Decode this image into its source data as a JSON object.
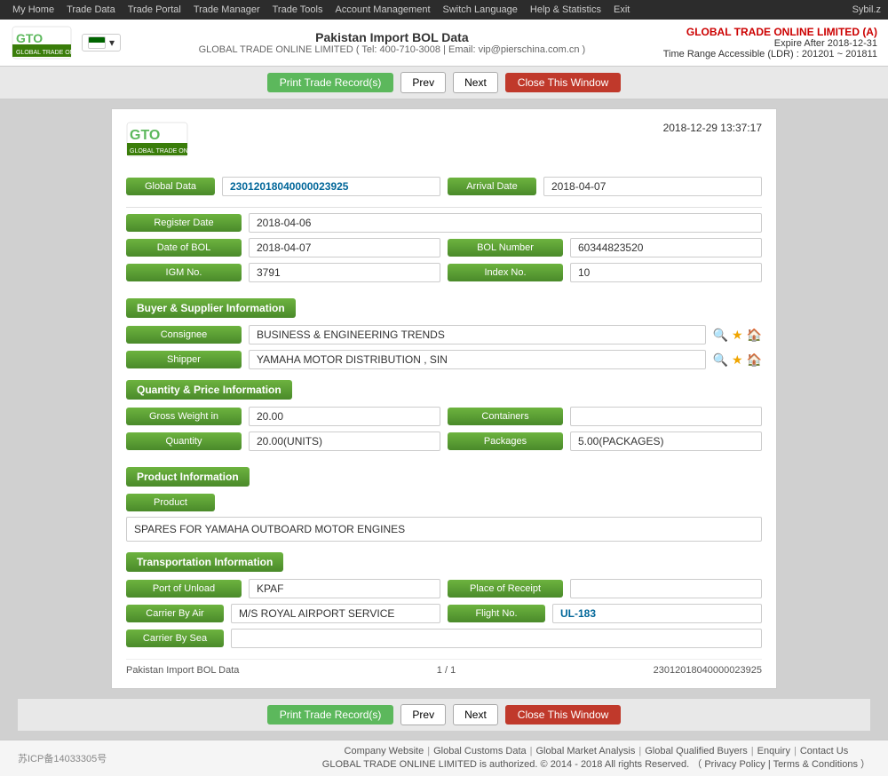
{
  "topNav": {
    "items": [
      "My Home",
      "Trade Data",
      "Trade Portal",
      "Trade Manager",
      "Trade Tools",
      "Account Management",
      "Switch Language",
      "Help & Statistics",
      "Exit"
    ],
    "user": "Sybil.z"
  },
  "header": {
    "title": "Pakistan Import BOL Data",
    "subtitle": "GLOBAL TRADE ONLINE LIMITED ( Tel: 400-710-3008 | Email: vip@pierschina.com.cn )",
    "company": "GLOBAL TRADE ONLINE LIMITED (A)",
    "expire": "Expire After 2018-12-31",
    "ldr": "Time Range Accessible (LDR) : 201201 ~ 201811"
  },
  "toolbar": {
    "print_label": "Print Trade Record(s)",
    "prev_label": "Prev",
    "next_label": "Next",
    "close_label": "Close This Window"
  },
  "record": {
    "timestamp": "2018-12-29 13:37:17",
    "global_data_label": "Global Data",
    "global_data_value": "23012018040000023925",
    "arrival_date_label": "Arrival Date",
    "arrival_date_value": "2018-04-07",
    "register_date_label": "Register Date",
    "register_date_value": "2018-04-06",
    "date_bol_label": "Date of BOL",
    "date_bol_value": "2018-04-07",
    "bol_number_label": "BOL Number",
    "bol_number_value": "60344823520",
    "igm_label": "IGM No.",
    "igm_value": "3791",
    "index_label": "Index No.",
    "index_value": "10",
    "buyer_supplier_section": "Buyer & Supplier Information",
    "consignee_label": "Consignee",
    "consignee_value": "BUSINESS & ENGINEERING TRENDS",
    "shipper_label": "Shipper",
    "shipper_value": "YAMAHA MOTOR DISTRIBUTION , SIN",
    "qty_price_section": "Quantity & Price Information",
    "gross_weight_label": "Gross Weight in",
    "gross_weight_value": "20.00",
    "containers_label": "Containers",
    "containers_value": "",
    "quantity_label": "Quantity",
    "quantity_value": "20.00(UNITS)",
    "packages_label": "Packages",
    "packages_value": "5.00(PACKAGES)",
    "product_section": "Product Information",
    "product_label": "Product",
    "product_value": "SPARES FOR YAMAHA OUTBOARD MOTOR ENGINES",
    "transport_section": "Transportation Information",
    "port_unload_label": "Port of Unload",
    "port_unload_value": "KPAF",
    "place_receipt_label": "Place of Receipt",
    "place_receipt_value": "",
    "carrier_air_label": "Carrier By Air",
    "carrier_air_value": "M/S ROYAL AIRPORT SERVICE",
    "flight_no_label": "Flight No.",
    "flight_no_value": "UL-183",
    "carrier_sea_label": "Carrier By Sea",
    "carrier_sea_value": "",
    "footer_left": "Pakistan Import BOL Data",
    "footer_middle": "1 / 1",
    "footer_right": "23012018040000023925"
  },
  "footer": {
    "icp": "苏ICP备14033305号",
    "links": [
      "Company Website",
      "Global Customs Data",
      "Global Market Analysis",
      "Global Qualified Buyers",
      "Enquiry",
      "Contact Us"
    ],
    "copyright": "GLOBAL TRADE ONLINE LIMITED is authorized. © 2014 - 2018 All rights Reserved. （ Privacy Policy | Terms & Conditions ）"
  }
}
